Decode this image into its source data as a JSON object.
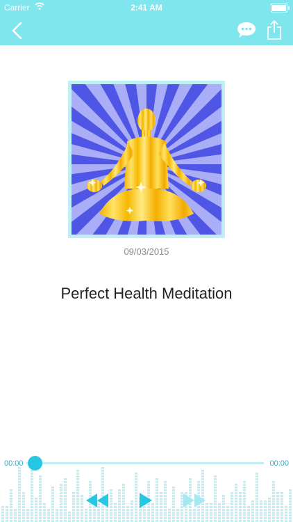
{
  "status_bar": {
    "carrier": "Carrier",
    "time": "2:41 AM"
  },
  "header": {
    "back_icon": "back-icon",
    "chat_icon": "chat-icon",
    "share_icon": "share-icon"
  },
  "content": {
    "artwork_icon": "meditation-figure",
    "date": "09/03/2015",
    "title": "Perfect Health Meditation"
  },
  "player": {
    "elapsed": "00:00",
    "duration": "00:00",
    "progress": 0
  },
  "colors": {
    "accent": "#7fe6ee",
    "knob": "#26c7e2",
    "title": "#222222",
    "date": "#8a8a8a"
  }
}
